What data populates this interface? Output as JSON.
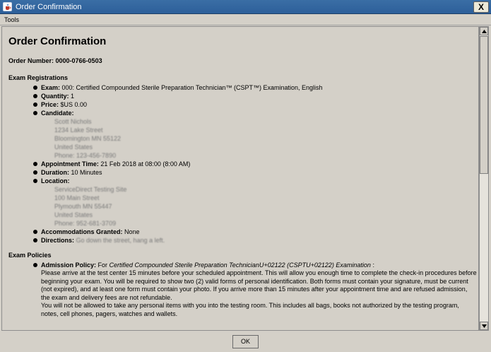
{
  "window": {
    "title": "Order Confirmation",
    "close_label": "X"
  },
  "menubar": {
    "tools_label": "Tools"
  },
  "page": {
    "title": "Order Confirmation",
    "order_number_label": "Order Number: ",
    "order_number_value": "0000-0766-0503"
  },
  "registrations": {
    "section_title": "Exam Registrations",
    "exam_label": "Exam:",
    "exam_value": " 000: Certified Compounded Sterile Preparation Technician™ (CSPT™) Examination, English",
    "quantity_label": "Quantity:",
    "quantity_value": " 1",
    "price_label": "Price:",
    "price_value": " $US 0.00",
    "candidate_label": "Candidate:",
    "candidate_address": [
      "Scott Nichols",
      "1234 Lake Street",
      "Bloomington MN 55122",
      "United States",
      "Phone: 123-456-7890"
    ],
    "appointment_label": "Appointment Time:",
    "appointment_value": " 21 Feb 2018 at 08:00 (8:00 AM)",
    "duration_label": "Duration:",
    "duration_value": " 10 Minutes",
    "location_label": "Location:",
    "location_address": [
      "ServiceDirect Testing Site",
      "100 Main Street",
      "Plymouth MN 55447",
      "United States",
      "Phone: 952-681-3709"
    ],
    "accommodations_label": "Accommodations Granted:",
    "accommodations_value": " None",
    "directions_label": "Directions:",
    "directions_value": " Go down the street, hang a left."
  },
  "policies": {
    "section_title": "Exam Policies",
    "admission_label": "Admission Policy:",
    "admission_intro_plain": " For ",
    "admission_intro_italic": "Certified Compounded Sterile Preparation TechnicianU+02122 (CSPTU+02122) Examination",
    "admission_intro_end": " :",
    "paragraph1": "Please arrive at the test center 15 minutes before your scheduled appointment. This will allow you enough time to complete the check-in procedures before beginning your exam. You will be required to show two (2) valid forms of personal identification. Both forms must contain your signature, must be current (not expired), and at least one form must contain your photo. If you arrive more than 15 minutes after your appointment time and are refused admission, the exam and delivery fees are not refundable.",
    "paragraph2": "You will not be allowed to take any personal items with you into the testing room. This includes all bags, books not authorized by the testing program, notes, cell phones, pagers, watches and wallets."
  },
  "footer": {
    "ok_label": "OK"
  }
}
